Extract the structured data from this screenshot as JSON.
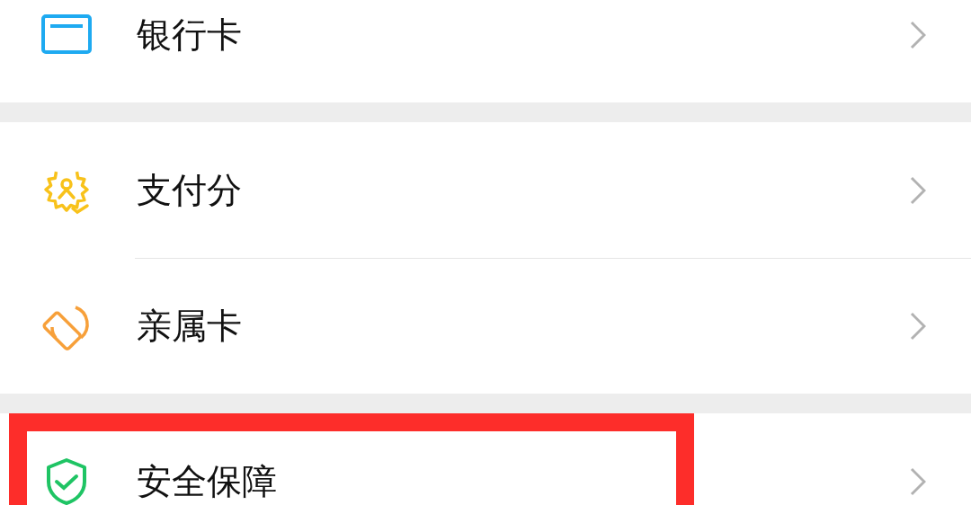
{
  "sections": [
    {
      "items": [
        {
          "label": "银行卡",
          "highlighted": false
        }
      ]
    },
    {
      "items": [
        {
          "label": "支付分",
          "highlighted": false
        },
        {
          "label": "亲属卡",
          "highlighted": false
        }
      ]
    },
    {
      "items": [
        {
          "label": "安全保障",
          "highlighted": true
        }
      ]
    }
  ]
}
